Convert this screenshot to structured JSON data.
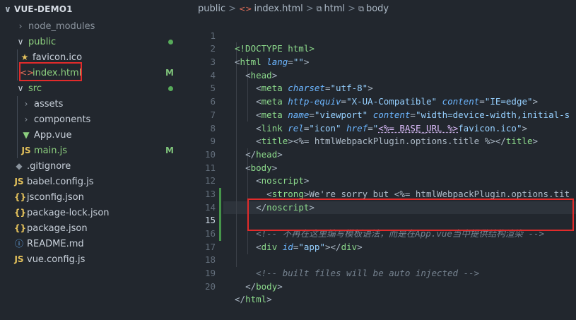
{
  "explorer": {
    "project": "VUE-DEMO1",
    "items": [
      {
        "label": "node_modules",
        "icon": "chevron-right-icon"
      },
      {
        "label": "public",
        "icon": "chevron-down-icon"
      },
      {
        "label": "favicon.ico",
        "icon": "star-icon"
      },
      {
        "label": "index.html",
        "icon": "html-icon",
        "badge": "M"
      },
      {
        "label": "src",
        "icon": "chevron-down-icon"
      },
      {
        "label": "assets",
        "icon": "chevron-right-icon"
      },
      {
        "label": "components",
        "icon": "chevron-right-icon"
      },
      {
        "label": "App.vue",
        "icon": "vue-icon"
      },
      {
        "label": "main.js",
        "icon": "js-icon",
        "badge": "M"
      },
      {
        "label": ".gitignore",
        "icon": "git-icon"
      },
      {
        "label": "babel.config.js",
        "icon": "js-icon"
      },
      {
        "label": "jsconfig.json",
        "icon": "json-icon"
      },
      {
        "label": "package-lock.json",
        "icon": "json-icon"
      },
      {
        "label": "package.json",
        "icon": "json-icon"
      },
      {
        "label": "README.md",
        "icon": "info-icon"
      },
      {
        "label": "vue.config.js",
        "icon": "js-icon"
      }
    ],
    "icon_glyphs": {
      "html": "<>",
      "js": "JS",
      "json": "{}",
      "star": "★",
      "vue": "▼",
      "git": "◆",
      "info": "ⓘ"
    }
  },
  "breadcrumb": {
    "folder": "public",
    "file": "index.html",
    "node1": "html",
    "node2": "body",
    "sep": ">"
  },
  "code": {
    "line_numbers": [
      "1",
      "2",
      "3",
      "4",
      "5",
      "6",
      "7",
      "8",
      "9",
      "10",
      "11",
      "12",
      "13",
      "14",
      "15",
      "16",
      "17",
      "18",
      "19",
      "20"
    ],
    "active_line": "15",
    "doctype": "<!DOCTYPE html>",
    "meta_charset": "utf-8",
    "meta_compat_equiv": "X-UA-Compatible",
    "meta_compat_content": "IE=edge",
    "meta_viewport_name": "viewport",
    "meta_viewport_content": "width=device-width,initial-s",
    "link_rel": "icon",
    "link_href_tmpl": "<%= BASE_URL %>",
    "link_href_file": "favicon.ico",
    "title_tmpl": "<%= htmlWebpackPlugin.options.title %>",
    "strong_text": "We're sorry but ",
    "strong_tmpl": "<%= htmlWebpackPlugin.options.tit",
    "comment_15": "<!-- 不再在这里编写模板语法，而是在App.vue当中提供结构渲染 -->",
    "div_id": "app",
    "comment_18": "<!-- built files will be auto injected -->"
  },
  "colors": {
    "highlight_box": "#e22b2b",
    "modified_badge": "#7ec27a",
    "git_added_gutter": "#46954a"
  }
}
